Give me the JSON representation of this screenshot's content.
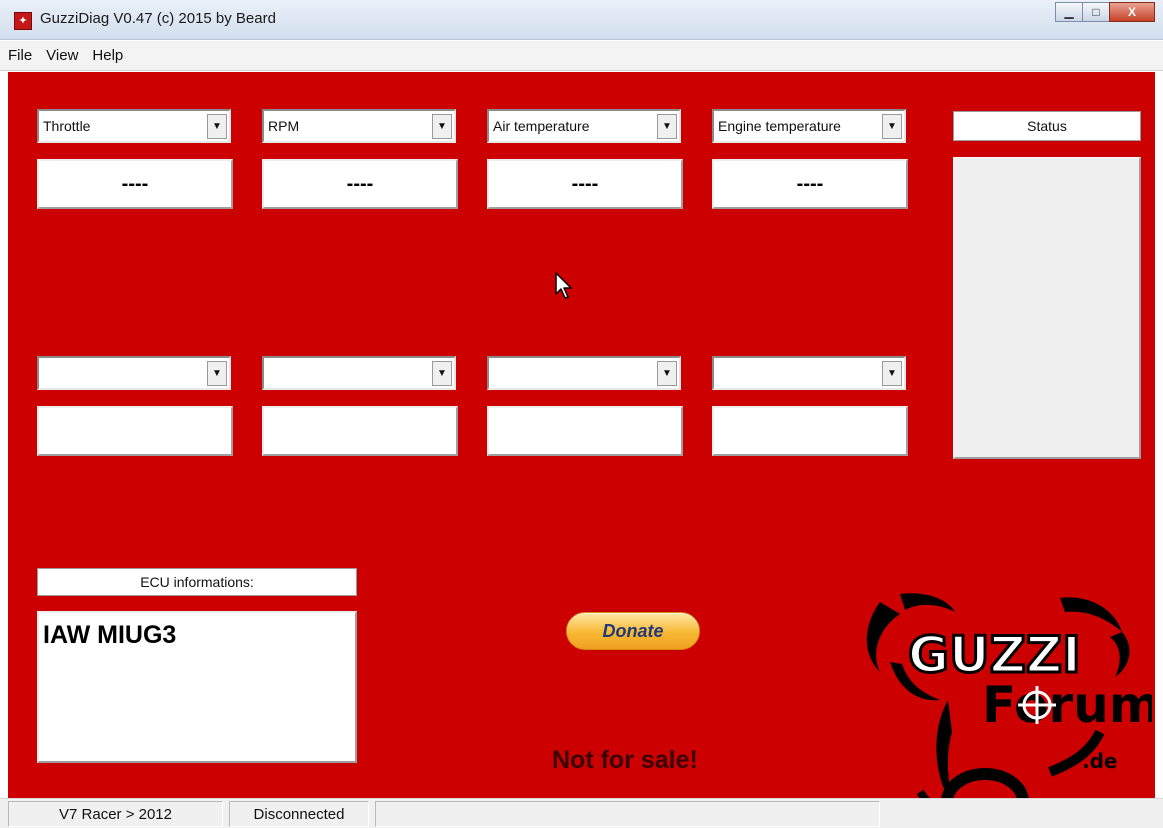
{
  "window": {
    "title": "GuzziDiag V0.47  (c) 2015 by Beard",
    "app_icon": "guzzi-app-icon",
    "minimize_glyph": "▁",
    "maximize_glyph": "□",
    "close_glyph": "X"
  },
  "menu": {
    "items": [
      "File",
      "View",
      "Help"
    ]
  },
  "monitors": {
    "row1": [
      {
        "selected": "Throttle",
        "value": "----"
      },
      {
        "selected": "RPM",
        "value": "----"
      },
      {
        "selected": "Air temperature",
        "value": "----"
      },
      {
        "selected": "Engine temperature",
        "value": "----"
      }
    ],
    "row2": [
      {
        "selected": "",
        "value": ""
      },
      {
        "selected": "",
        "value": ""
      },
      {
        "selected": "",
        "value": ""
      },
      {
        "selected": "",
        "value": ""
      }
    ],
    "dropdown_glyph": "▼"
  },
  "status": {
    "header": "Status",
    "content": ""
  },
  "ecu": {
    "header": "ECU informations:",
    "value": "IAW MIUG3"
  },
  "donate": {
    "label": "Donate"
  },
  "notice": "Not for sale!",
  "logo": {
    "line1": "GUZZI",
    "line2": "Forum",
    "line3": ".de"
  },
  "statusbar": {
    "model": "V7 Racer > 2012",
    "connection": "Disconnected",
    "extra": ""
  },
  "colors": {
    "panel_red": "#cc0000",
    "donate_text": "#1f3a7a"
  }
}
